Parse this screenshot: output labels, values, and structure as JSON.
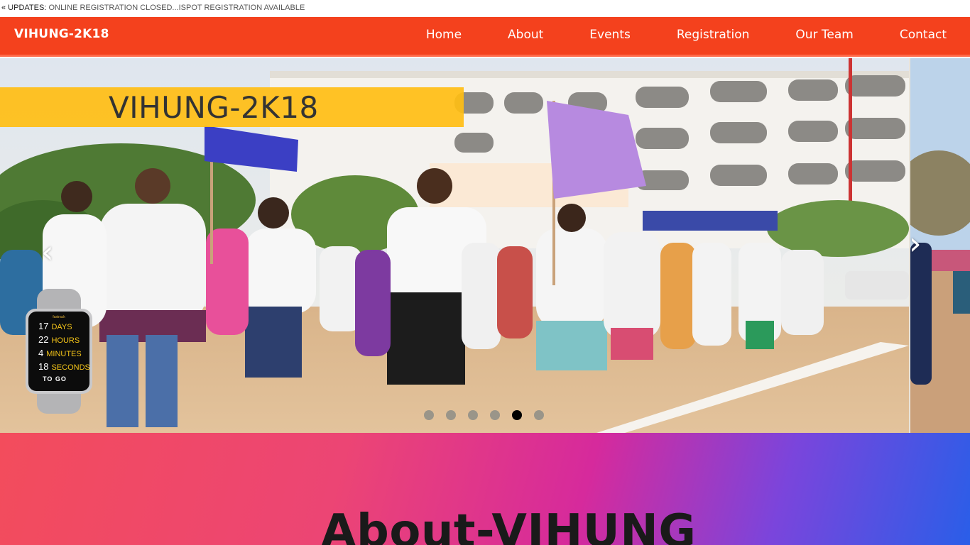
{
  "ticker": {
    "label": "« UPDATES:",
    "message": "ONLINE REGISTRATION CLOSED...ISPOT REGISTRATION AVAILABLE"
  },
  "navbar": {
    "brand": "VIHUNG-2K18",
    "links": [
      "Home",
      "About",
      "Events",
      "Registration",
      "Our Team",
      "Contact"
    ],
    "background_color": "#f4411d"
  },
  "carousel": {
    "slide_title": "VIHUNG-2K18",
    "prev_label": "‹",
    "next_label": "›",
    "slide_count": 6,
    "active_index": 4
  },
  "countdown": {
    "brand": "fastrack",
    "days_value": "17",
    "days_unit": "DAYS",
    "hours_value": "22",
    "hours_unit": "HOURS",
    "minutes_value": "4",
    "minutes_unit": "MINUTES",
    "seconds_value": "18",
    "seconds_unit": "SECONDS",
    "suffix": "TO GO"
  },
  "about": {
    "title": "About-VIHUNG"
  }
}
